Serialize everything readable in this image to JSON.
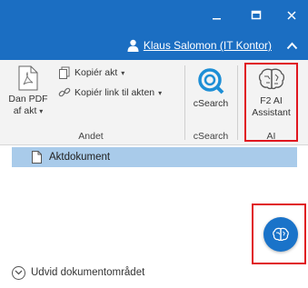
{
  "titlebar": {
    "color": "#1b6ec2",
    "user_name": "Klaus Salomon (IT Kontor)",
    "icons": [
      "minimize-icon",
      "maximize-icon",
      "close-icon",
      "user-icon",
      "chevron-up-icon"
    ]
  },
  "ribbon": {
    "andet": {
      "label": "Andet",
      "dan_pdf_label_line1": "Dan PDF",
      "dan_pdf_label_line2": "af akt",
      "kopier_akt_label": "Kopiér akt",
      "kopier_link_label": "Kopiér link til akten"
    },
    "csearch": {
      "label": "cSearch",
      "button_label": "cSearch"
    },
    "ai": {
      "label": "AI",
      "button_line1": "F2 AI",
      "button_line2": "Assistant"
    }
  },
  "document_list": {
    "selected_item": "Aktdokument",
    "selected_color": "#a9cbea"
  },
  "footer": {
    "expand_label": "Udvid dokumentområdet"
  },
  "fab": {
    "icon": "brain-icon",
    "color": "#1a73c9"
  },
  "highlight_color": "#e0171f"
}
